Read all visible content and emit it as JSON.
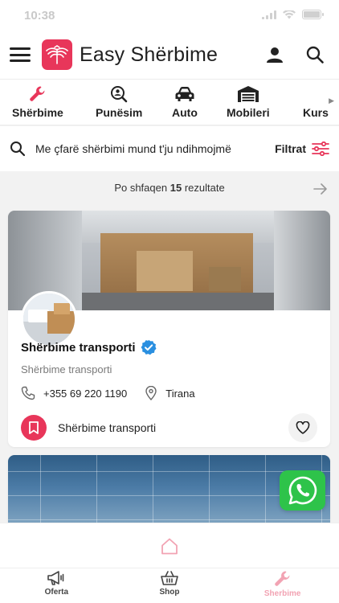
{
  "status_bar": {
    "time": "10:38"
  },
  "header": {
    "app_name": "Easy Shërbime",
    "brand_color": "#e8365a",
    "icons": [
      "menu-icon",
      "user-icon",
      "search-icon"
    ]
  },
  "categories": [
    {
      "label": "Shërbime",
      "icon": "wrench-icon",
      "active": true
    },
    {
      "label": "Punësim",
      "icon": "job-search-icon"
    },
    {
      "label": "Auto",
      "icon": "car-icon"
    },
    {
      "label": "Mobileri",
      "icon": "garage-icon"
    },
    {
      "label": "Kurs",
      "icon": "course-icon"
    }
  ],
  "search": {
    "placeholder": "Me çfarë shërbimi mund t'ju ndihmojmë",
    "filter_label": "Filtrat"
  },
  "results": {
    "prefix": "Po shfaqen",
    "count": "15",
    "suffix": "rezultate"
  },
  "listings": [
    {
      "title": "Shërbime transporti",
      "verified": true,
      "subtitle": "Shërbime transporti",
      "phone": "+355 69 220 1190",
      "city": "Tirana",
      "category_label": "Shërbime transporti"
    }
  ],
  "tabbar": {
    "tabs": [
      {
        "label": "Oferta",
        "icon": "megaphone-icon"
      },
      {
        "label": "Shop",
        "icon": "basket-icon"
      },
      {
        "label": "Sherbime",
        "icon": "wrench-icon",
        "active": true
      }
    ]
  },
  "colors": {
    "accent": "#e8365a",
    "accent_light": "#f2a3b3",
    "verified": "#2a8fe0",
    "whatsapp": "#2ec34a"
  }
}
